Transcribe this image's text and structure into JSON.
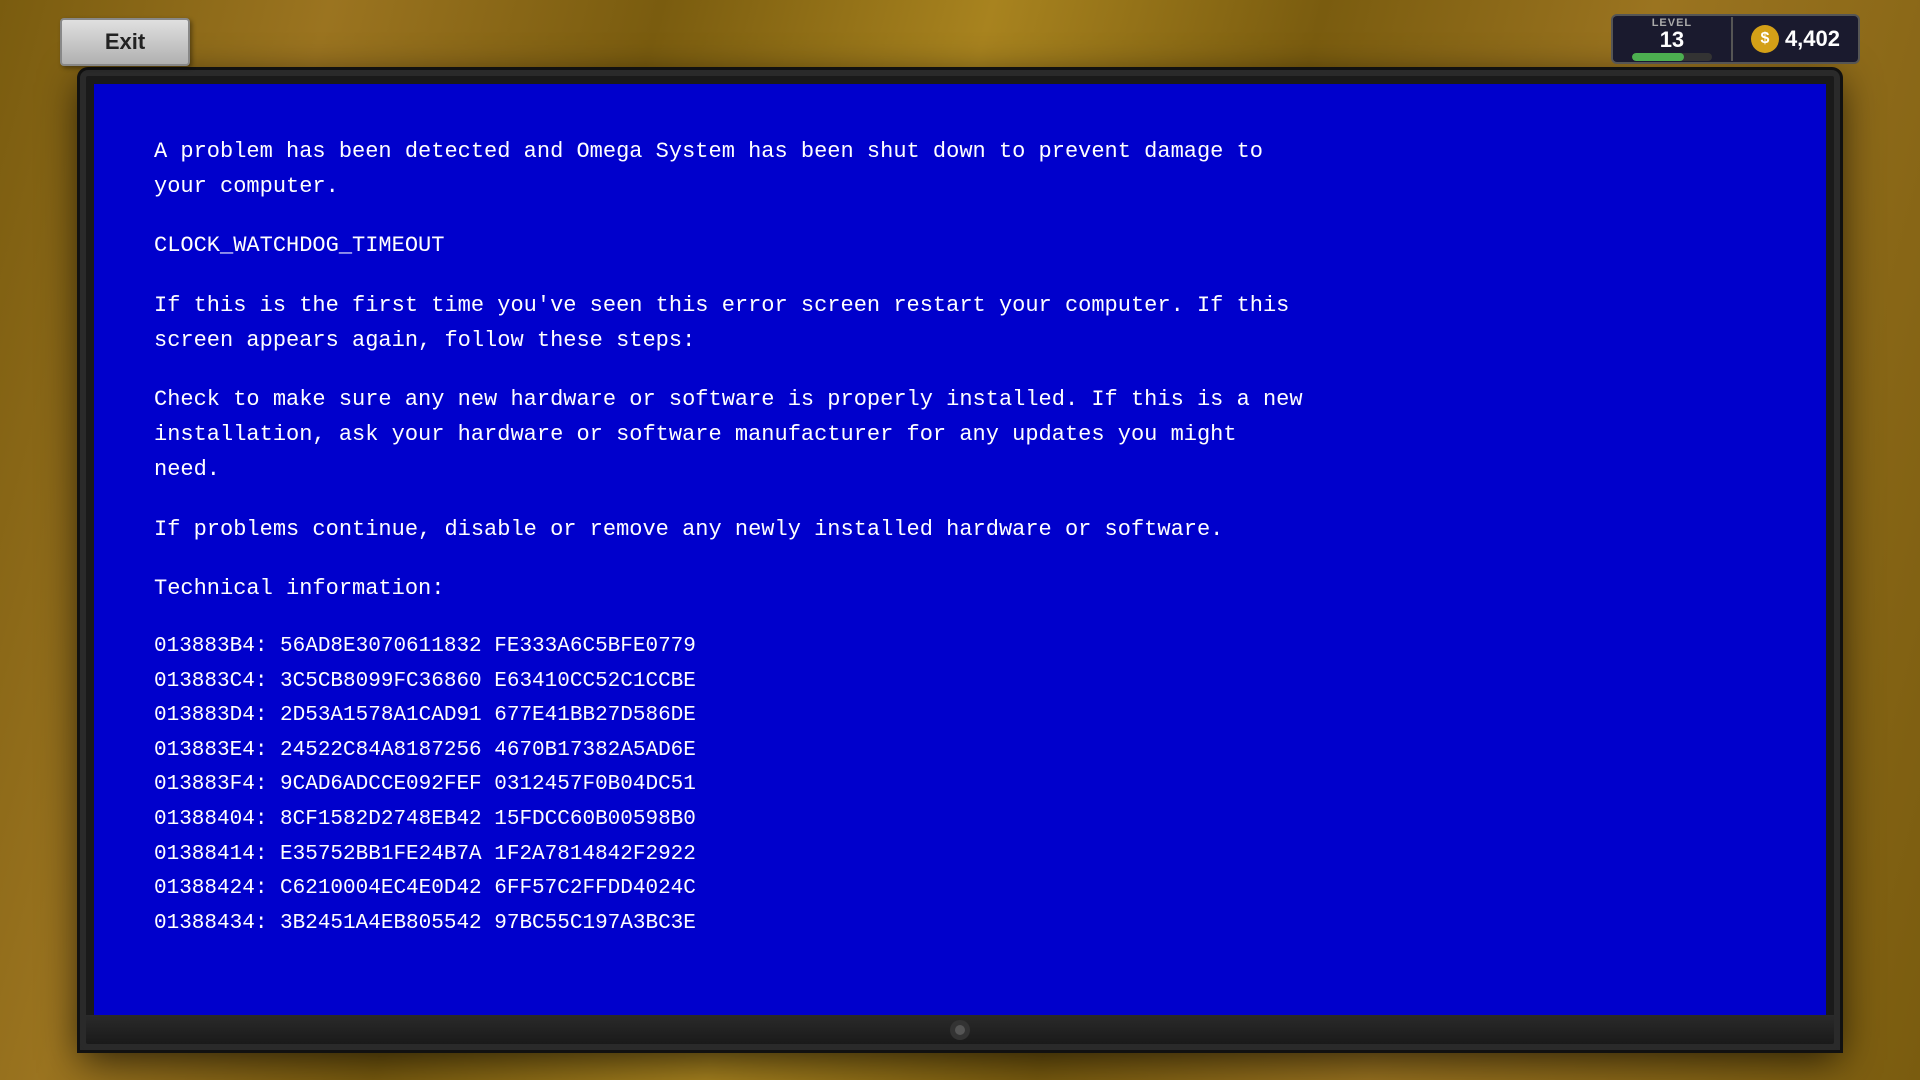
{
  "ui": {
    "exit_button": "Exit",
    "hud": {
      "level_label": "LEVEL",
      "level_number": "13",
      "xp_percent": 65,
      "dollar_symbol": "$",
      "money": "4,402"
    }
  },
  "bsod": {
    "line1": "A problem has been detected and Omega System has been shut down to prevent damage to",
    "line2": "your computer.",
    "error_code": "CLOCK_WATCHDOG_TIMEOUT",
    "para1": "If this is the first time you've seen this error screen restart your computer. If this\nscreen appears again, follow these steps:",
    "para2": "Check to make sure any new hardware or software is properly installed. If this is a new\ninstallation, ask your hardware or software manufacturer for any updates you might\nneed.",
    "para3": "If problems continue, disable or remove any newly installed hardware or software.",
    "tech_label": "Technical information:",
    "tech_rows": [
      {
        "addr": "013883B4:",
        "val1": "56AD8E3070611832",
        "val2": "FE333A6C5BFE0779"
      },
      {
        "addr": "013883C4:",
        "val1": "3C5CB8099FC36860",
        "val2": "E63410CC52C1CCBE"
      },
      {
        "addr": "013883D4:",
        "val1": "2D53A1578A1CAD91",
        "val2": "677E41BB27D586DE"
      },
      {
        "addr": "013883E4:",
        "val1": "24522C84A8187256",
        "val2": "4670B17382A5AD6E"
      },
      {
        "addr": "013883F4:",
        "val1": "9CAD6ADCCE092FEF",
        "val2": "0312457F0B04DC51"
      },
      {
        "addr": "01388404:",
        "val1": "8CF1582D2748EB42",
        "val2": "15FDCC60B00598B0"
      },
      {
        "addr": "01388414:",
        "val1": "E35752BB1FE24B7A",
        "val2": "1F2A7814842F2922"
      },
      {
        "addr": "01388424:",
        "val1": "C6210004EC4E0D42",
        "val2": "6FF57C2FFDD4024C"
      },
      {
        "addr": "01388434:",
        "val1": "3B2451A4EB805542",
        "val2": "97BC55C197A3BC3E"
      }
    ]
  }
}
